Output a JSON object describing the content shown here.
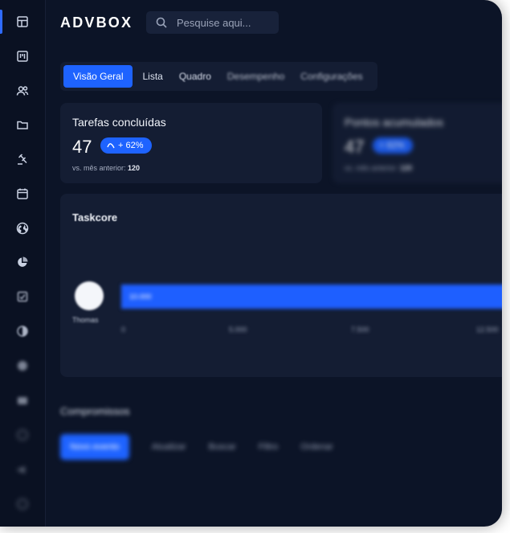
{
  "app": {
    "logo": "ADVBOX"
  },
  "search": {
    "placeholder": "Pesquise aqui..."
  },
  "sidebar": {
    "icons": [
      "layout-icon",
      "kanban-icon",
      "users-icon",
      "folder-icon",
      "gavel-icon",
      "calendar-icon",
      "globe-icon",
      "chart-pie-icon",
      "checkbox-icon",
      "pie-icon",
      "gear-icon",
      "card-icon",
      "clock-icon",
      "megaphone-icon",
      "support-icon"
    ]
  },
  "tabs": [
    {
      "label": "Visão Geral",
      "active": true
    },
    {
      "label": "Lista",
      "active": false
    },
    {
      "label": "Quadro",
      "active": false
    },
    {
      "label": "Desempenho",
      "active": false
    },
    {
      "label": "Configurações",
      "active": false
    }
  ],
  "cards": [
    {
      "title": "Tarefas concluídas",
      "value": "47",
      "badge": "+ 62%",
      "foot_label": "vs. mês anterior:",
      "foot_value": "120"
    },
    {
      "title": "Pontos acumulados",
      "value": "47",
      "badge": "+ 62%",
      "foot_label": "vs. mês anterior:",
      "foot_value": "120"
    }
  ],
  "taskcore": {
    "title": "Taskcore",
    "user_name": "Thomas",
    "bar_label": "10.000",
    "progress_fraction": 0.97,
    "axis_ticks": [
      "0",
      "5.000",
      "7.500",
      "12.500"
    ]
  },
  "section": {
    "title": "Compromissos",
    "chips": [
      "Novo evento",
      "Atualizar",
      "Buscar",
      "Filtro",
      "Ordenar"
    ]
  },
  "colors": {
    "accent": "#1e63ff",
    "bg": "#0c1427",
    "card": "#141d33"
  }
}
